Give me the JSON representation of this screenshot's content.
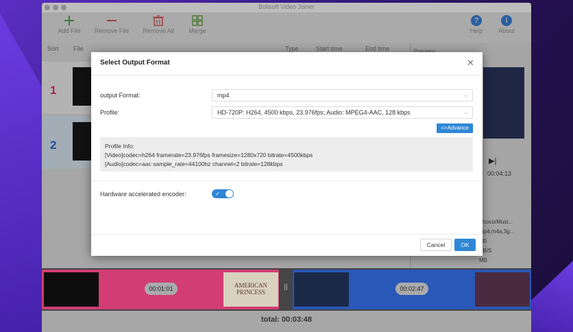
{
  "window": {
    "title": "Bolisoft Video Joiner"
  },
  "toolbar": {
    "add_file": "Add File",
    "remove_file": "Remove File",
    "remove_all": "Remove All",
    "merge": "Merge",
    "help": "Help",
    "about": "About",
    "help_glyph": "?",
    "about_glyph": "i"
  },
  "file_list": {
    "headers": {
      "sort": "Sort",
      "file": "File",
      "type": "Type",
      "start_time": "Start time",
      "end_time": "End time"
    },
    "rows": [
      {
        "num": "1"
      },
      {
        "num": "2"
      }
    ]
  },
  "preview": {
    "title": "Preview",
    "time": "00:04:13",
    "info_lines": [
      "s/coco/Musi...",
      "mp4,m4a,3g...",
      ":00",
      "KB/S",
      "MB"
    ]
  },
  "timeline": {
    "clips": [
      {
        "time": "00:01:01"
      },
      {
        "time": "00:02:47"
      }
    ],
    "thumb_text": "AMERICAN PRINCESS",
    "total": "total: 00:03:48"
  },
  "dialog": {
    "title": "Select Output Format",
    "close_glyph": "✕",
    "output_format_label": "output Format:",
    "output_format_value": "mp4",
    "profile_label": "Profile:",
    "profile_value": "HD-720P: H264, 4500 kbps, 23.976fps; Audio: MPEG4-AAC, 128 kbps",
    "advance_label": "=>Advance",
    "profile_info": {
      "heading": "Profile Info:",
      "video": "[Video]codec=h264 framerate=23.976fps framesize=1280x720 bitrate=4500kbps",
      "audio": "[Audio]codec=aac sample_rate=44100hz channel=2 bitrate=128kbps"
    },
    "hw_label": "Hardware accelerated encoder:",
    "hw_enabled": true,
    "cancel_label": "Cancel",
    "ok_label": "OK"
  },
  "colors": {
    "accent": "#2f86d6",
    "clip_pink": "#d23e73",
    "clip_blue": "#2958b8",
    "add_icon_green": "#3a8a3a",
    "remove_icon_red": "#b83a3a",
    "merge_icon_green": "#5a8a3a"
  }
}
